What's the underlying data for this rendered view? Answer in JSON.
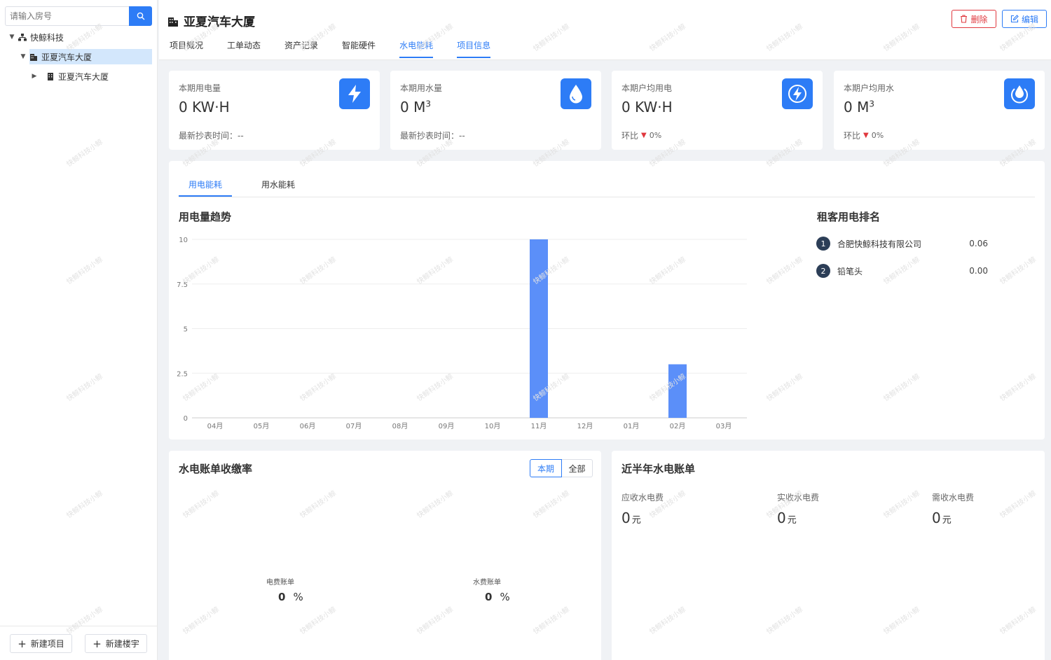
{
  "sidebar": {
    "search_placeholder": "请输入房号",
    "tree": [
      {
        "label": "快鲸科技"
      },
      {
        "label": "亚夏汽车大厦"
      },
      {
        "label": "亚夏汽车大厦"
      }
    ],
    "new_project": "新建项目",
    "new_building": "新建楼宇"
  },
  "header": {
    "title": "亚夏汽车大厦",
    "tabs": [
      "项目概况",
      "工单动态",
      "资产记录",
      "智能硬件",
      "水电能耗",
      "项目信息"
    ],
    "active_tab": "水电能耗",
    "delete_label": "删除",
    "edit_label": "编辑"
  },
  "stats": [
    {
      "label": "本期用电量",
      "value": "0",
      "unit": "KW·H",
      "sub_label": "最新抄表时间：--",
      "icon": "lightning-icon"
    },
    {
      "label": "本期用水量",
      "value": "0",
      "unit": "M",
      "unit_sup": "3",
      "sub_label": "最新抄表时间：--",
      "icon": "water-drop-icon"
    },
    {
      "label": "本期户均用电",
      "value": "0",
      "unit": "KW·H",
      "sub_label": "环比",
      "change": "0%",
      "icon": "bolt-circle-icon"
    },
    {
      "label": "本期户均用水",
      "value": "0",
      "unit": "M",
      "unit_sup": "3",
      "sub_label": "环比",
      "change": "0%",
      "icon": "water-circle-icon"
    }
  ],
  "energy": {
    "tabs": [
      "用电能耗",
      "用水能耗"
    ],
    "trend_title": "用电量趋势",
    "ranking_title": "租客用电排名",
    "ranking": [
      {
        "rank": "1",
        "name": "合肥快鲸科技有限公司",
        "value": "0.06"
      },
      {
        "rank": "2",
        "name": "铅笔头",
        "value": "0.00"
      }
    ]
  },
  "chart_data": {
    "type": "bar",
    "categories": [
      "04月",
      "05月",
      "06月",
      "07月",
      "08月",
      "09月",
      "10月",
      "11月",
      "12月",
      "01月",
      "02月",
      "03月"
    ],
    "values": [
      0,
      0,
      0,
      0,
      0,
      0,
      0,
      10,
      0,
      0,
      3,
      0
    ],
    "yticks": [
      "0",
      "2.5",
      "5",
      "7.5",
      "10"
    ],
    "ylim": [
      0,
      10
    ],
    "color": "#5b8ff9",
    "title": "用电量趋势"
  },
  "collection": {
    "title": "水电账单收缴率",
    "seg": [
      "本期",
      "全部"
    ],
    "electric_label": "电费账单",
    "electric_value": "0",
    "water_label": "水费账单",
    "water_value": "0",
    "percent": "%"
  },
  "bills": {
    "title": "近半年水电账单",
    "items": [
      {
        "label": "应收水电费",
        "value": "0",
        "unit": "元"
      },
      {
        "label": "实收水电费",
        "value": "0",
        "unit": "元"
      },
      {
        "label": "需收水电费",
        "value": "0",
        "unit": "元"
      }
    ]
  },
  "watermark": "快鲸科技小鲸",
  "colors": {
    "primary": "#2d7cf6",
    "danger": "#e0383e",
    "bar": "#5b8ff9"
  }
}
